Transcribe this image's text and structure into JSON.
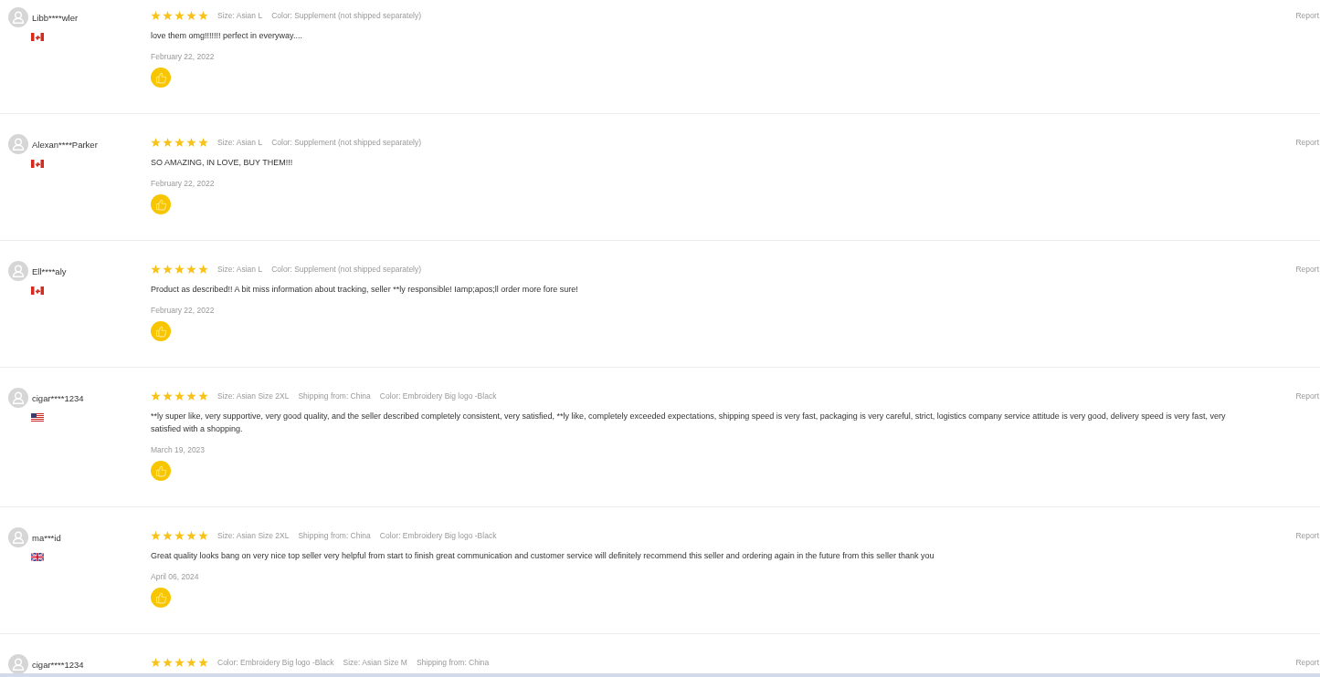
{
  "reviews": [
    {
      "user": "Libb****wler",
      "flag": {
        "kind": "canada"
      },
      "stars": 5,
      "attributes": [
        "Size: Asian L",
        "Color: Supplement (not shipped separately)"
      ],
      "text": "love them omg!!!!!!! perfect in everyway....",
      "date": "February 22, 2022",
      "helpful_button": true,
      "report": "Report"
    },
    {
      "user": "Alexan****Parker",
      "flag": {
        "kind": "canada"
      },
      "stars": 5,
      "attributes": [
        "Size: Asian L",
        "Color: Supplement (not shipped separately)"
      ],
      "text": "SO AMAZING, IN LOVE, BUY THEM!!!",
      "date": "February 22, 2022",
      "helpful_button": true,
      "report": "Report"
    },
    {
      "user": "Ell****aly",
      "flag": {
        "kind": "canada"
      },
      "stars": 5,
      "attributes": [
        "Size: Asian L",
        "Color: Supplement (not shipped separately)"
      ],
      "text": "Product as described!! A bit miss information about tracking, seller **ly responsible! Iamp;apos;ll order more fore sure!",
      "date": "February 22, 2022",
      "helpful_button": true,
      "report": "Report"
    },
    {
      "user": "cigar****1234",
      "flag": {
        "kind": "usa"
      },
      "stars": 5,
      "attributes": [
        "Size: Asian Size 2XL",
        "Shipping from: China",
        "Color: Embroidery Big logo -Black"
      ],
      "text": "**ly super like, very supportive, very good quality, and the seller described completely consistent, very satisfied, **ly like, completely exceeded expectations, shipping speed is very fast, packaging is very careful, strict, logistics company service attitude is very good, delivery speed is very fast, very satisfied with a shopping.",
      "date": "March 19, 2023",
      "helpful_button": true,
      "report": "Report"
    },
    {
      "user": "ma***id",
      "flag": {
        "kind": "uk"
      },
      "stars": 5,
      "attributes": [
        "Size: Asian Size 2XL",
        "Shipping from: China",
        "Color: Embroidery Big logo -Black"
      ],
      "text": "Great quality looks bang on very nice top seller very helpful from start to finish great communication and customer service will definitely recommend this seller and ordering again in the future from this seller thank you",
      "date": "April 06, 2024",
      "helpful_button": true,
      "report": "Report"
    },
    {
      "user": "cigar****1234",
      "stars": 5,
      "attributes": [
        "Color: Embroidery Big logo -Black",
        "Size: Asian Size M",
        "Shipping from: China"
      ],
      "report": "Report"
    }
  ]
}
